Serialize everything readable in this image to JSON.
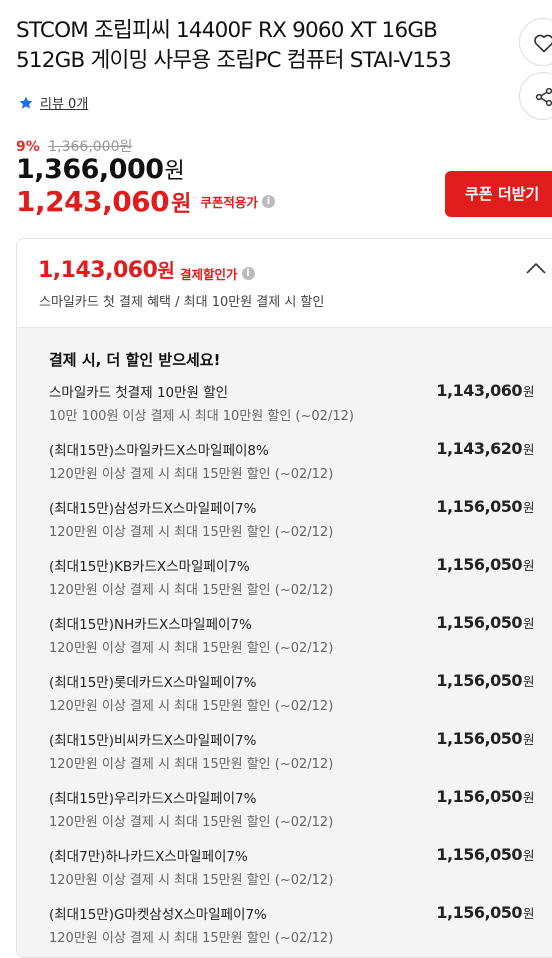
{
  "product": {
    "title": "STCOM 조립피씨 14400F RX 9060 XT 16GB 512GB 게이밍 사무용 조립PC 컴퓨터 STAI-V153"
  },
  "review": {
    "icon": "star-icon",
    "label": "리뷰 0개"
  },
  "pricing": {
    "discount_rate": "9%",
    "original_price": "1,366,000원",
    "price": "1,366,000",
    "price_unit": "원",
    "coupon_price": "1,243,060",
    "coupon_unit": "원",
    "coupon_label": "쿠폰적용가",
    "coupon_button": "쿠폰 더받기"
  },
  "payment_discount": {
    "price": "1,143,060",
    "unit": "원",
    "label": "결제할인가",
    "subtitle": "스마일카드 첫 결제 혜택 / 최대 10만원 결제 시 할인",
    "section_title": "결제 시, 더 할인 받으세요!",
    "offers": [
      {
        "name": "스마일카드 첫결제 10만원 할인",
        "price": "1,143,060",
        "unit": "원",
        "condition": "10만 100원 이상 결제 시 최대 10만원 할인 (~02/12)"
      },
      {
        "name": "(최대15만)스마일카드X스마일페이8%",
        "price": "1,143,620",
        "unit": "원",
        "condition": "120만원 이상 결제 시 최대 15만원 할인 (~02/12)"
      },
      {
        "name": "(최대15만)삼성카드X스마일페이7%",
        "price": "1,156,050",
        "unit": "원",
        "condition": "120만원 이상 결제 시 최대 15만원 할인 (~02/12)"
      },
      {
        "name": "(최대15만)KB카드X스마일페이7%",
        "price": "1,156,050",
        "unit": "원",
        "condition": "120만원 이상 결제 시 최대 15만원 할인 (~02/12)"
      },
      {
        "name": "(최대15만)NH카드X스마일페이7%",
        "price": "1,156,050",
        "unit": "원",
        "condition": "120만원 이상 결제 시 최대 15만원 할인 (~02/12)"
      },
      {
        "name": "(최대15만)롯데카드X스마일페이7%",
        "price": "1,156,050",
        "unit": "원",
        "condition": "120만원 이상 결제 시 최대 15만원 할인 (~02/12)"
      },
      {
        "name": "(최대15만)비씨카드X스마일페이7%",
        "price": "1,156,050",
        "unit": "원",
        "condition": "120만원 이상 결제 시 최대 15만원 할인 (~02/12)"
      },
      {
        "name": "(최대15만)우리카드X스마일페이7%",
        "price": "1,156,050",
        "unit": "원",
        "condition": "120만원 이상 결제 시 최대 15만원 할인 (~02/12)"
      },
      {
        "name": "(최대7만)하나카드X스마일페이7%",
        "price": "1,156,050",
        "unit": "원",
        "condition": "120만원 이상 결제 시 최대 15만원 할인 (~02/12)"
      },
      {
        "name": "(최대15만)G마켓삼성X스마일페이7%",
        "price": "1,156,050",
        "unit": "원",
        "condition": "120만원 이상 결제 시 최대 15만원 할인 (~02/12)"
      }
    ]
  },
  "icons": {
    "wishlist": "heart-icon",
    "share": "share-icon",
    "collapse": "chevron-up-icon",
    "info": "info-icon"
  },
  "colors": {
    "accent_red": "#e01c1c",
    "discount_red": "#e03131",
    "star_blue": "#1a6ee8"
  }
}
